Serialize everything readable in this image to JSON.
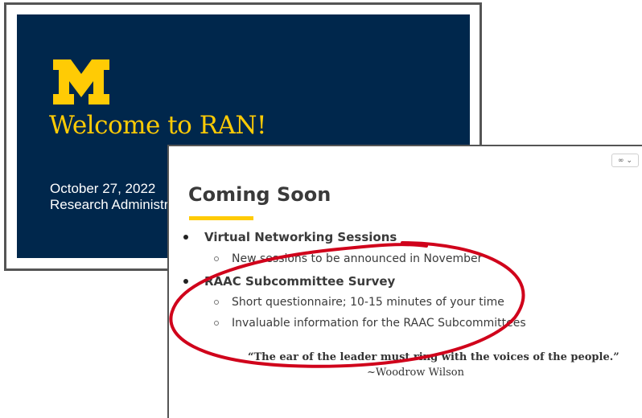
{
  "back_slide": {
    "logo_letter": "M",
    "title": "Welcome to RAN!",
    "date": "October 27, 2022",
    "org": "Research Administr"
  },
  "front_slide": {
    "link_toggle_icon": "link-icon",
    "title": "Coming Soon",
    "bullets": [
      {
        "label": "Virtual Networking Sessions",
        "subitems": [
          "New sessions to be announced in November"
        ]
      },
      {
        "label": "RAAC Subcommittee Survey",
        "subitems": [
          "Short questionnaire; 10-15 minutes of your time",
          "Invaluable information for the RAAC Subcommittees"
        ]
      }
    ],
    "quote": "“The ear of the leader must ring with the voices of the people.”",
    "quote_author": "~Woodrow Wilson"
  },
  "colors": {
    "maize": "#ffcb05",
    "blue": "#00274c",
    "annotation": "#d0021b"
  }
}
